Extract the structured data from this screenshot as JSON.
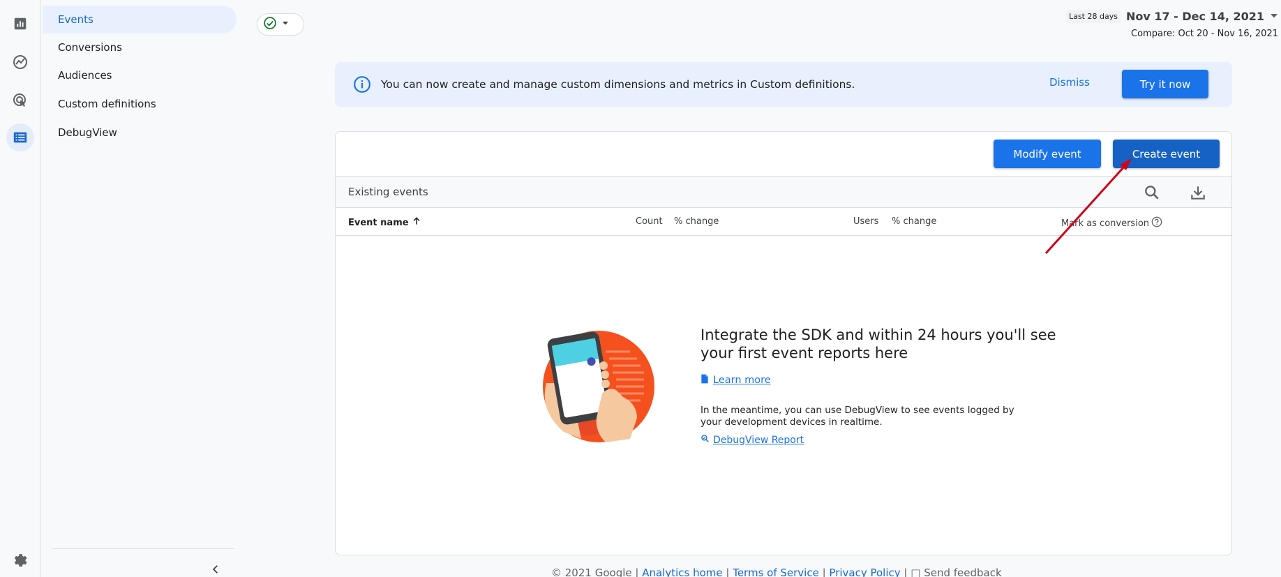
{
  "sidebar": {
    "items": [
      {
        "label": "Events",
        "active": true
      },
      {
        "label": "Conversions",
        "active": false
      },
      {
        "label": "Audiences",
        "active": false
      },
      {
        "label": "Custom definitions",
        "active": false
      },
      {
        "label": "DebugView",
        "active": false
      }
    ]
  },
  "rail": {
    "icons": [
      "reports-icon",
      "explore-icon",
      "advertising-icon",
      "configure-icon",
      "admin-gear-icon"
    ]
  },
  "date": {
    "chip": "Last 28 days",
    "range": "Nov 17 - Dec 14, 2021",
    "compare": "Compare: Oct 20 - Nov 16, 2021"
  },
  "banner": {
    "text": "You can now create and manage custom dimensions and metrics in Custom definitions.",
    "dismiss": "Dismiss",
    "try": "Try it now"
  },
  "toolbar": {
    "modify": "Modify event",
    "create": "Create event"
  },
  "events": {
    "section_title": "Existing events",
    "columns": {
      "event_name": "Event name",
      "count": "Count",
      "count_change": "% change",
      "users": "Users",
      "users_change": "% change",
      "conversion": "Mark as conversion"
    }
  },
  "empty_state": {
    "title": "Integrate the SDK and within 24 hours you'll see your first event reports here",
    "learn_more": "Learn more",
    "description": "In the meantime, you can use DebugView to see events logged by your development devices in realtime.",
    "debugview_link": "DebugView Report"
  },
  "footer": {
    "copyright": "© 2021 Google",
    "analytics_home": "Analytics home",
    "terms": "Terms of Service",
    "privacy": "Privacy Policy",
    "feedback": "Send feedback"
  },
  "colors": {
    "accent": "#1a73e8",
    "active_nav_bg": "#e8f0fe",
    "banner_bg": "#e8f0fe",
    "annotation_arrow": "#d0021b",
    "status_ok": "#188038"
  }
}
